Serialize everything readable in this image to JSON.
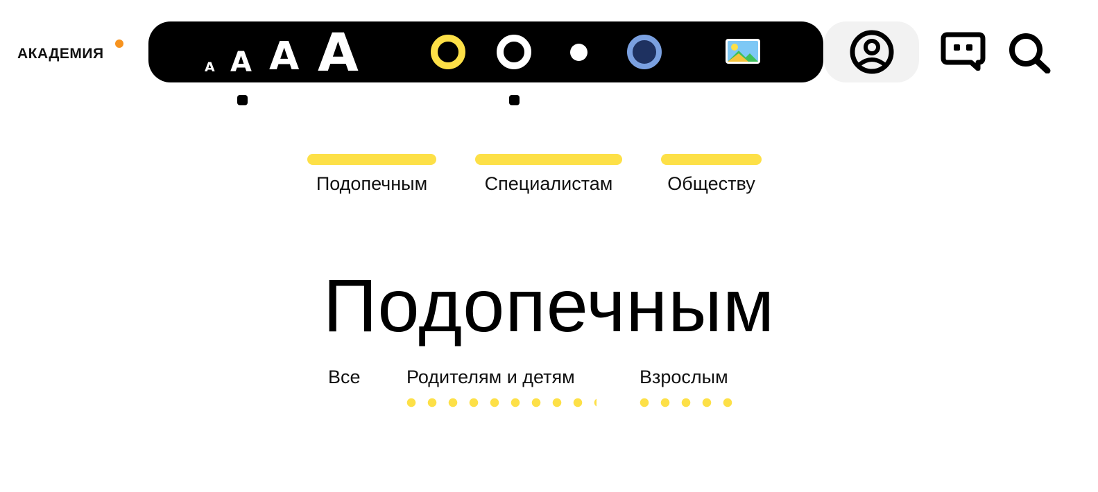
{
  "logo": {
    "text": "АКАДЕМИЯ",
    "dot_color": "#f7931e"
  },
  "accessibility": {
    "font_sizes": [
      {
        "name": "font-size-smallest",
        "label": "A"
      },
      {
        "name": "font-size-small",
        "label": "A"
      },
      {
        "name": "font-size-medium",
        "label": "A"
      },
      {
        "name": "font-size-large",
        "label": "A"
      }
    ],
    "selected_font_size_index": 1,
    "color_schemes": [
      {
        "name": "yellow-on-black",
        "ring": "#fde047",
        "fill": "#000000"
      },
      {
        "name": "white-on-black",
        "ring": "#ffffff",
        "fill": "#000000"
      },
      {
        "name": "small-white-dot",
        "ring": "#ffffff",
        "fill": "#ffffff"
      },
      {
        "name": "blue-scheme",
        "ring": "#7aa0e0",
        "fill": "#1e3160"
      }
    ],
    "selected_scheme_index": 1,
    "image_toggle_icon": "image-icon"
  },
  "header_icons": {
    "account": "user-account-icon",
    "chat": "chat-icon",
    "search": "search-icon"
  },
  "audience_tabs": [
    {
      "label": "Подопечным"
    },
    {
      "label": "Специалистам"
    },
    {
      "label": "Обществу"
    }
  ],
  "page_title": "Подопечным",
  "sub_tabs": [
    {
      "label": "Все"
    },
    {
      "label": "Родителям и детям"
    },
    {
      "label": "Взрослым"
    }
  ],
  "colors": {
    "accent_yellow": "#fde047",
    "bar_background": "#000000",
    "account_background": "#f2f2f2"
  }
}
